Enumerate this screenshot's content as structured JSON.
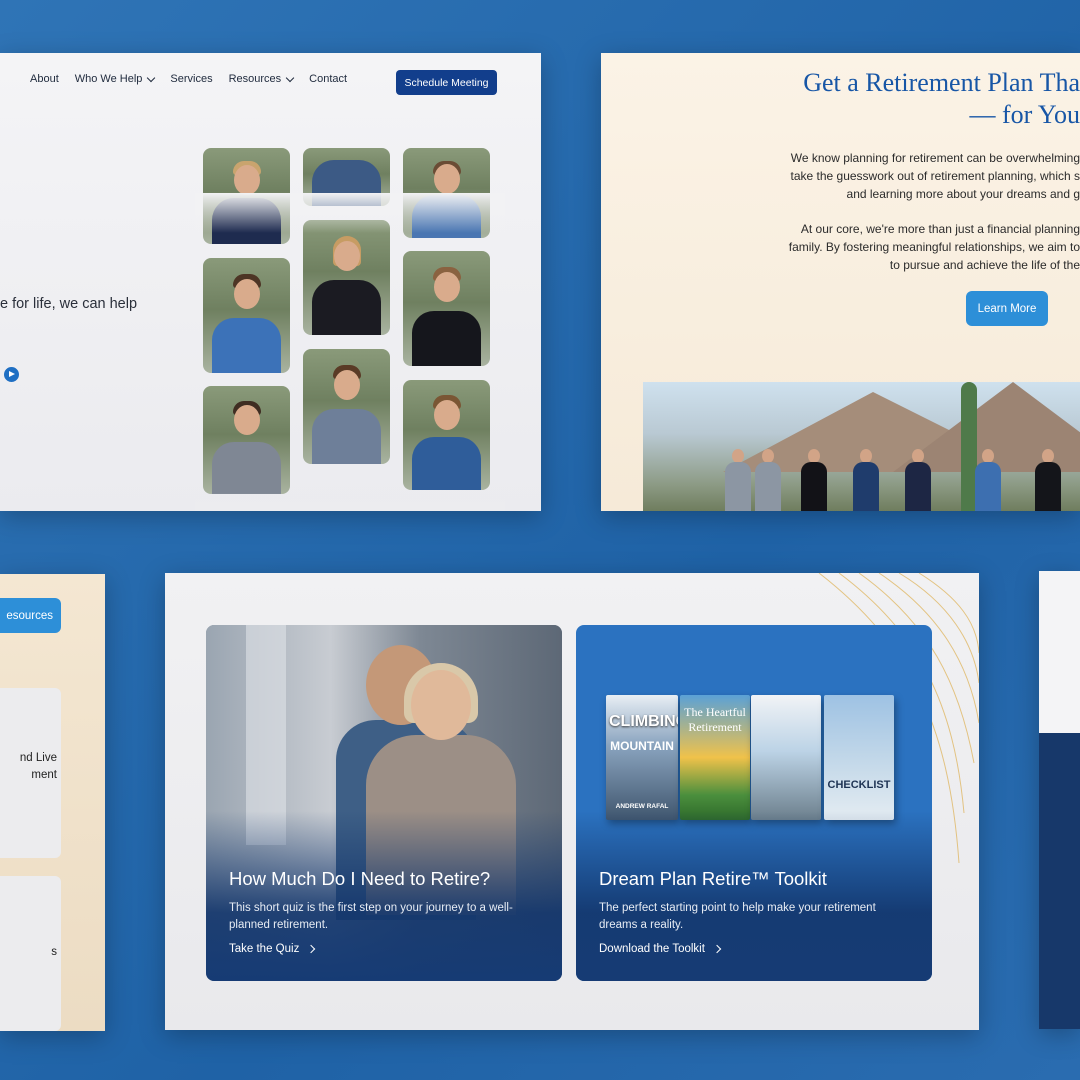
{
  "nav": {
    "items": [
      "About",
      "Who We Help",
      "Services",
      "Resources",
      "Contact"
    ],
    "schedule_label": "Schedule Meeting"
  },
  "hero": {
    "partial_text": "e for life, we can help"
  },
  "plan": {
    "title": "Get a Retirement Plan Tha\n— for You",
    "para1": "We know planning for retirement can be overwhelming\ntake the guesswork out of retirement planning, which s\nand learning more about your dreams and g",
    "para2": "At our core, we're more than just a financial planning\nfamily. By fostering meaningful relationships, we aim to\nto pursue and achieve the life of the",
    "learn_more": "Learn More"
  },
  "side": {
    "resources_label": "esources",
    "card1_text": "nd Live\nment",
    "card2_text": "s"
  },
  "cards": [
    {
      "title": "How Much Do I Need to Retire?",
      "desc": "This short quiz is the first step on your journey to a well-planned retirement.",
      "link": "Take the Quiz"
    },
    {
      "title": "Dream Plan Retire™ Toolkit",
      "desc": "The perfect starting point to help make your retirement dreams a reality.",
      "link": "Download the Toolkit"
    }
  ],
  "books": [
    {
      "title": "CLIMBING",
      "subtitle": "MOUNTAIN",
      "author": "ANDREW RAFAL"
    },
    {
      "title": "The Heartful Retirement"
    },
    {
      "title": ""
    },
    {
      "title": "CHECKLIST"
    }
  ],
  "colors": {
    "background": "#2a6db0",
    "nav_button": "#123e8c",
    "accent_button": "#2d8fd8",
    "title_blue": "#1756a6",
    "card_overlay": "#163b74"
  }
}
